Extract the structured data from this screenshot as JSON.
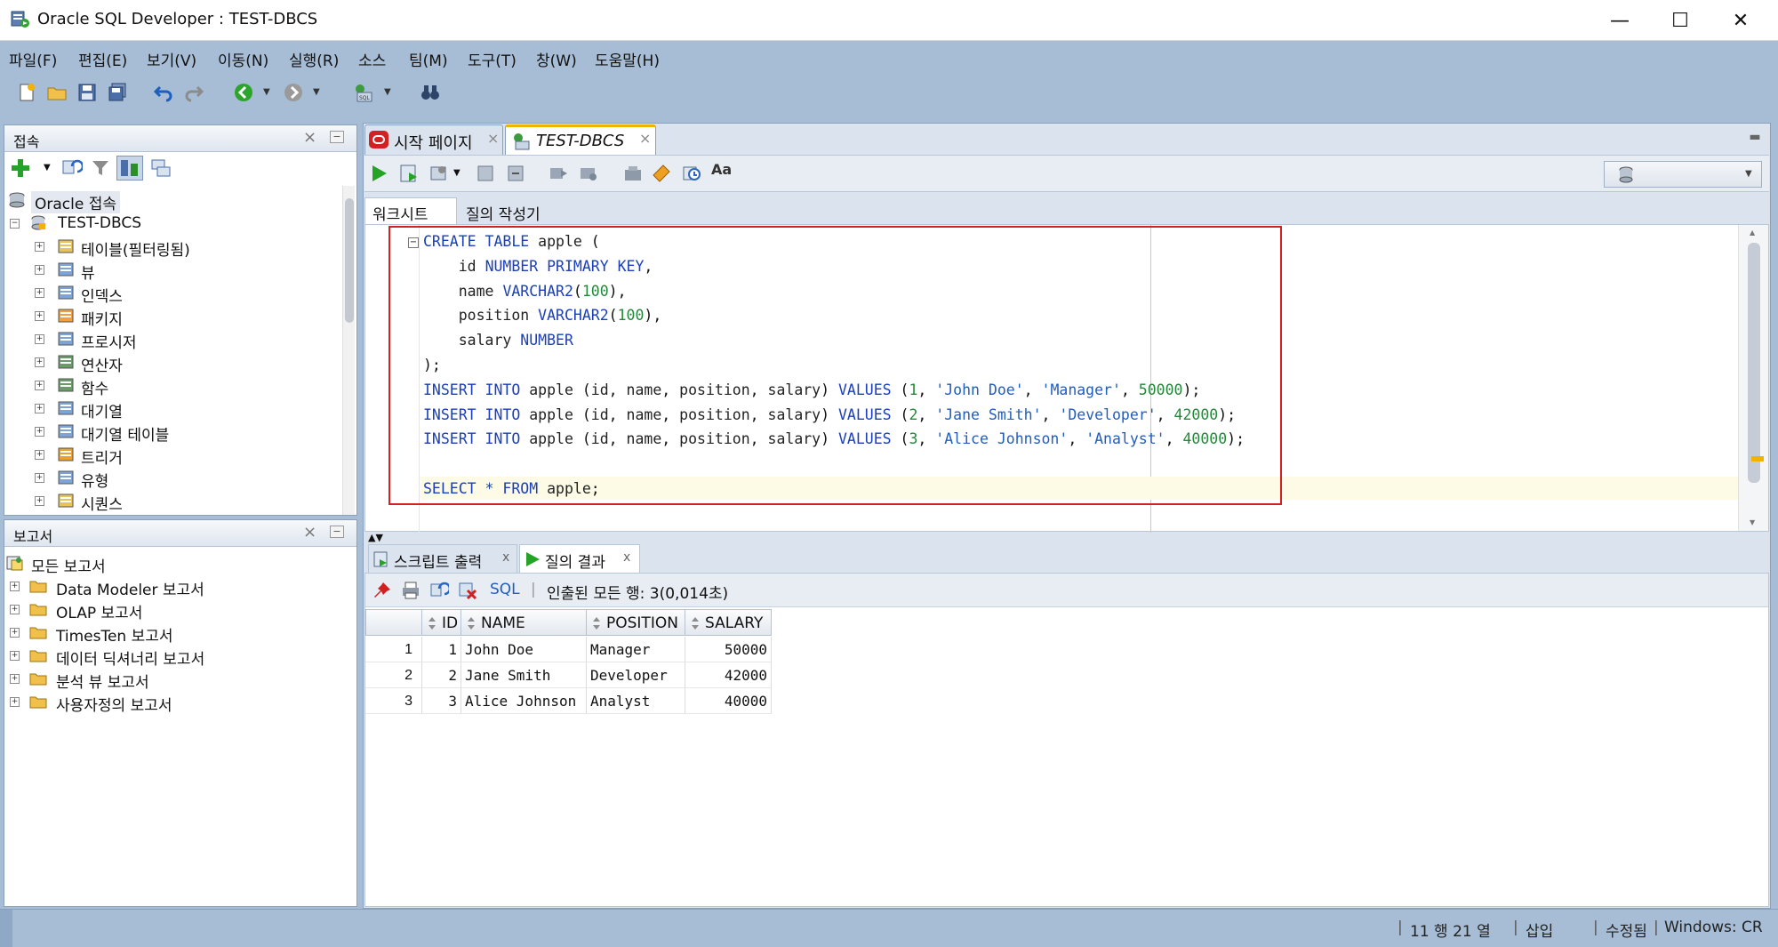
{
  "window": {
    "title": "Oracle SQL Developer : TEST-DBCS"
  },
  "menu": [
    "파일(F)",
    "편집(E)",
    "보기(V)",
    "이동(N)",
    "실행(R)",
    "소스",
    "팀(M)",
    "도구(T)",
    "창(W)",
    "도움말(H)"
  ],
  "connections_panel": {
    "title": "접속",
    "root": "Oracle 접속",
    "connection": "TEST-DBCS",
    "items": [
      "테이블(필터링됨)",
      "뷰",
      "인덱스",
      "패키지",
      "프로시저",
      "연산자",
      "함수",
      "대기열",
      "대기열 테이블",
      "트리거",
      "유형",
      "시퀀스"
    ]
  },
  "reports_panel": {
    "title": "보고서",
    "root": "모든 보고서",
    "items": [
      "Data Modeler 보고서",
      "OLAP 보고서",
      "TimesTen 보고서",
      "데이터 딕셔너리 보고서",
      "분석 뷰 보고서",
      "사용자정의 보고서"
    ]
  },
  "doc_tabs": [
    {
      "label": "시작 페이지",
      "close": "×"
    },
    {
      "label": "TEST-DBCS",
      "close": "×"
    }
  ],
  "worksheet_tabs": [
    "워크시트",
    "질의 작성기"
  ],
  "sql_lines": [
    "CREATE TABLE apple (",
    "    id NUMBER PRIMARY KEY,",
    "    name VARCHAR2(100),",
    "    position VARCHAR2(100),",
    "    salary NUMBER",
    ");",
    "INSERT INTO apple (id, name, position, salary) VALUES (1, 'John Doe', 'Manager', 50000);",
    "INSERT INTO apple (id, name, position, salary) VALUES (2, 'Jane Smith', 'Developer', 42000);",
    "INSERT INTO apple (id, name, position, salary) VALUES (3, 'Alice Johnson', 'Analyst', 40000);",
    "",
    "SELECT * FROM apple;"
  ],
  "result_tabs": [
    {
      "label": "스크립트 출력",
      "close": "x"
    },
    {
      "label": "질의 결과",
      "close": "x"
    }
  ],
  "result_toolbar": {
    "sql_link": "SQL",
    "separator": "|",
    "fetched": "인출된 모든 행: 3(0,014초)"
  },
  "result_grid": {
    "columns": [
      "ID",
      "NAME",
      "POSITION",
      "SALARY"
    ],
    "rows": [
      {
        "rownum": "1",
        "id": "1",
        "name": "John Doe",
        "position": "Manager",
        "salary": "50000"
      },
      {
        "rownum": "2",
        "id": "2",
        "name": "Jane Smith",
        "position": "Developer",
        "salary": "42000"
      },
      {
        "rownum": "3",
        "id": "3",
        "name": "Alice Johnson",
        "position": "Analyst",
        "salary": "40000"
      }
    ]
  },
  "statusbar": {
    "position": "11 행 21 열",
    "mode": "삽입",
    "modified": "수정됨",
    "eol": "Windows: CR"
  },
  "window_controls": {
    "minimize": "—",
    "maximize": "☐",
    "close": "✕"
  },
  "panel_controls": {
    "close": "×",
    "minimize": "−"
  },
  "colors": {
    "frame": "#a7bdd6",
    "highlight_box": "#d42020",
    "keyword": "#1a3fb8",
    "number": "#23893a"
  }
}
